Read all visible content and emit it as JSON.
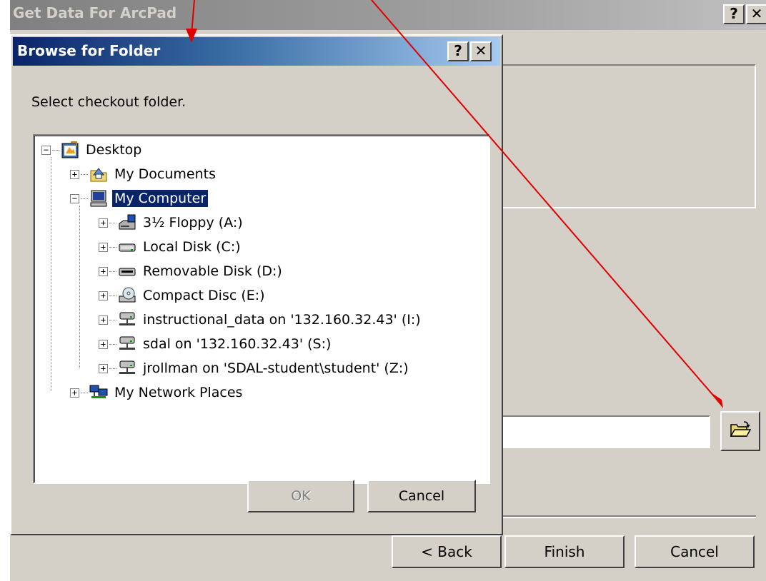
{
  "wizard": {
    "title": "Get Data For ArcPad",
    "help_label": "?",
    "close_label": "✕",
    "back_label": "< Back",
    "finish_label": "Finish",
    "cancel_label": "Cancel",
    "path_value": ""
  },
  "dialog": {
    "title": "Browse for Folder",
    "help_label": "?",
    "close_label": "✕",
    "prompt": "Select checkout folder.",
    "ok_label": "OK",
    "cancel_label": "Cancel",
    "selected_item": "My Computer",
    "tree": [
      {
        "label": "Desktop",
        "icon": "desktop-icon",
        "expander": "−"
      },
      {
        "label": "My Documents",
        "icon": "my-documents-icon",
        "expander": "+"
      },
      {
        "label": "My Computer",
        "icon": "my-computer-icon",
        "expander": "−"
      },
      {
        "label": "3½ Floppy (A:)",
        "icon": "floppy-drive-icon",
        "expander": "+"
      },
      {
        "label": "Local Disk (C:)",
        "icon": "hard-disk-icon",
        "expander": "+"
      },
      {
        "label": "Removable Disk (D:)",
        "icon": "removable-disk-icon",
        "expander": "+"
      },
      {
        "label": "Compact Disc (E:)",
        "icon": "cd-drive-icon",
        "expander": "+"
      },
      {
        "label": "instructional_data on '132.160.32.43' (I:)",
        "icon": "network-drive-icon",
        "expander": "+"
      },
      {
        "label": "sdal on '132.160.32.43' (S:)",
        "icon": "network-drive-icon",
        "expander": "+"
      },
      {
        "label": "jrollman on 'SDAL-student\\student' (Z:)",
        "icon": "network-drive-icon",
        "expander": "+"
      },
      {
        "label": "My Network Places",
        "icon": "network-places-icon",
        "expander": "+"
      }
    ]
  },
  "colors": {
    "window_face": "#d4d0c8",
    "active_title": "#0a246a",
    "selection": "#0a246a",
    "annotation_arrow": "#e00000"
  }
}
